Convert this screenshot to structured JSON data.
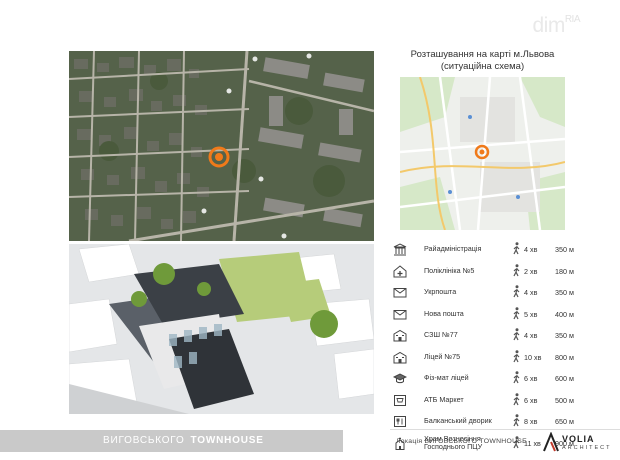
{
  "watermark": {
    "text": "dim",
    "suffix": "RIA"
  },
  "map_panel": {
    "title_line1": "Розташування на карті м.Львова",
    "title_line2": "(ситуаційна схема)"
  },
  "project": {
    "title_regular": "ВИГОВСЬКОГО",
    "title_bold": "TOWNHOUSE"
  },
  "footer": {
    "location_label": "Локація   ВИГОВСЬКОГО   TOWNHOUSE",
    "brand": "VOLIA",
    "brand_sub": "ARCHITECT"
  },
  "poi": [
    {
      "name": "Райадміністрація",
      "minutes": "4 хв",
      "distance": "350 м",
      "icon": "government-building-icon"
    },
    {
      "name": "Поліклініка №5",
      "minutes": "2 хв",
      "distance": "180 м",
      "icon": "clinic-icon"
    },
    {
      "name": "Укрпошта",
      "minutes": "4 хв",
      "distance": "350 м",
      "icon": "mail-envelope-icon"
    },
    {
      "name": "Нова пошта",
      "minutes": "5 хв",
      "distance": "400 м",
      "icon": "mail-envelope-icon"
    },
    {
      "name": "СЗШ №77",
      "minutes": "4 хв",
      "distance": "350 м",
      "icon": "school-building-icon"
    },
    {
      "name": "Ліцей №75",
      "minutes": "10 хв",
      "distance": "800 м",
      "icon": "school-building-icon"
    },
    {
      "name": "Фіз-мат ліцей",
      "minutes": "6 хв",
      "distance": "600 м",
      "icon": "graduation-cap-icon"
    },
    {
      "name": "АТБ Маркет",
      "minutes": "6 хв",
      "distance": "500 м",
      "icon": "shopping-cart-icon"
    },
    {
      "name": "Балканський дворик",
      "minutes": "8 хв",
      "distance": "650 м",
      "icon": "restaurant-icon"
    },
    {
      "name": "Храм Вознесіння Господнього ПЦУ",
      "minutes": "11 хв",
      "distance": "900 м",
      "icon": "church-icon"
    }
  ],
  "colors": {
    "marker": "#f07a1a",
    "bar": "#c9c9c9",
    "text": "#333333"
  }
}
